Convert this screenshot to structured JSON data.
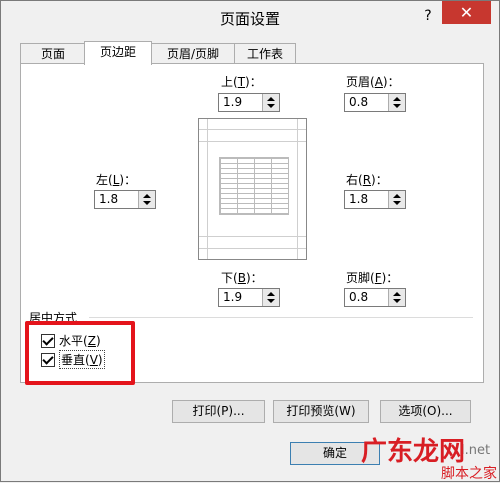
{
  "dialog": {
    "title": "页面设置",
    "help": "?",
    "close": "✕"
  },
  "tabs": [
    "页面",
    "页边距",
    "页眉/页脚",
    "工作表"
  ],
  "margins": {
    "top": {
      "label": "上",
      "key": "T",
      "value": "1.9"
    },
    "header": {
      "label": "页眉",
      "key": "A",
      "value": "0.8"
    },
    "left": {
      "label": "左",
      "key": "L",
      "value": "1.8"
    },
    "right": {
      "label": "右",
      "key": "R",
      "value": "1.8"
    },
    "bottom": {
      "label": "下",
      "key": "B",
      "value": "1.9"
    },
    "footer": {
      "label": "页脚",
      "key": "F",
      "value": "0.8"
    }
  },
  "center": {
    "group_label": "居中方式",
    "horizontal": {
      "label": "水平",
      "key": "Z",
      "checked": true
    },
    "vertical": {
      "label": "垂直",
      "key": "V",
      "checked": true
    }
  },
  "buttons": {
    "print": "打印(P)...",
    "preview": "打印预览(W)",
    "options": "选项(O)...",
    "ok": "确定"
  },
  "watermark": {
    "big": "广东龙网",
    "small": "脚本之家",
    "frag": "l.net"
  },
  "colors": {
    "highlight": "#e4141b",
    "close_bg": "#c7372f"
  }
}
